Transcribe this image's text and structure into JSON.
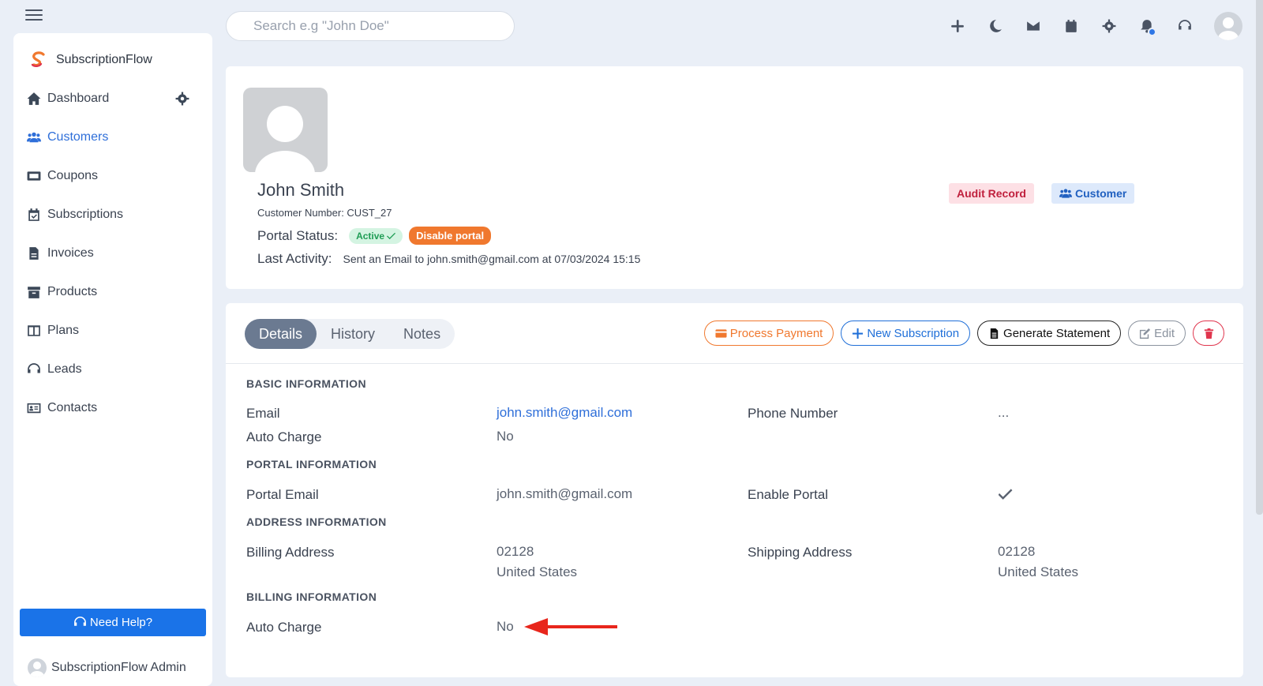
{
  "search": {
    "placeholder": "Search e.g \"John Doe\""
  },
  "header": {
    "icons": [
      "plus-icon",
      "moon-icon",
      "mail-icon",
      "calendar-icon",
      "gear-icon",
      "bell-icon",
      "headset-icon",
      "user-avatar"
    ]
  },
  "sidebar": {
    "brand": "SubscriptionFlow",
    "items": [
      {
        "label": "Dashboard",
        "icon": "home-icon"
      },
      {
        "label": "Customers",
        "icon": "users-icon",
        "active": true
      },
      {
        "label": "Coupons",
        "icon": "ticket-icon"
      },
      {
        "label": "Subscriptions",
        "icon": "calendar-check-icon"
      },
      {
        "label": "Invoices",
        "icon": "invoice-icon"
      },
      {
        "label": "Products",
        "icon": "archive-icon"
      },
      {
        "label": "Plans",
        "icon": "columns-icon"
      },
      {
        "label": "Leads",
        "icon": "headset-icon"
      },
      {
        "label": "Contacts",
        "icon": "id-card-icon"
      }
    ],
    "help_label": "Need Help?",
    "admin_name": "SubscriptionFlow Admin"
  },
  "profile": {
    "name": "John Smith",
    "customer_number": "Customer Number: CUST_27",
    "portal_status_label": "Portal Status:",
    "portal_status": "Active",
    "disable_portal_label": "Disable portal",
    "last_activity_label": "Last Activity:",
    "last_activity": "Sent an Email to john.smith@gmail.com at 07/03/2024 15:15",
    "tag_audit": "Audit Record",
    "tag_customer": "Customer"
  },
  "details": {
    "tabs": [
      "Details",
      "History",
      "Notes"
    ],
    "active_tab": "Details",
    "actions": {
      "process_payment": "Process Payment",
      "new_subscription": "New Subscription",
      "generate_statement": "Generate Statement",
      "edit": "Edit"
    },
    "sections": {
      "basic": "BASIC INFORMATION",
      "portal": "PORTAL INFORMATION",
      "address": "ADDRESS INFORMATION",
      "billing": "BILLING INFORMATION"
    },
    "fields": {
      "email_label": "Email",
      "email_value": "john.smith@gmail.com",
      "phone_label": "Phone Number",
      "phone_value": "...",
      "auto_charge_label": "Auto Charge",
      "auto_charge_value": "No",
      "portal_email_label": "Portal Email",
      "portal_email_value": "john.smith@gmail.com",
      "enable_portal_label": "Enable Portal",
      "billing_address_label": "Billing Address",
      "billing_address_line1": "02128",
      "billing_address_line2": "United States",
      "shipping_address_label": "Shipping Address",
      "shipping_address_line1": "02128",
      "shipping_address_line2": "United States",
      "billing_auto_charge_label": "Auto Charge",
      "billing_auto_charge_value": "No"
    }
  },
  "colors": {
    "accent": "#1a73e8",
    "active_nav": "#2f6fd9",
    "annotation_arrow": "#e8261c",
    "background": "#eaeff7"
  }
}
